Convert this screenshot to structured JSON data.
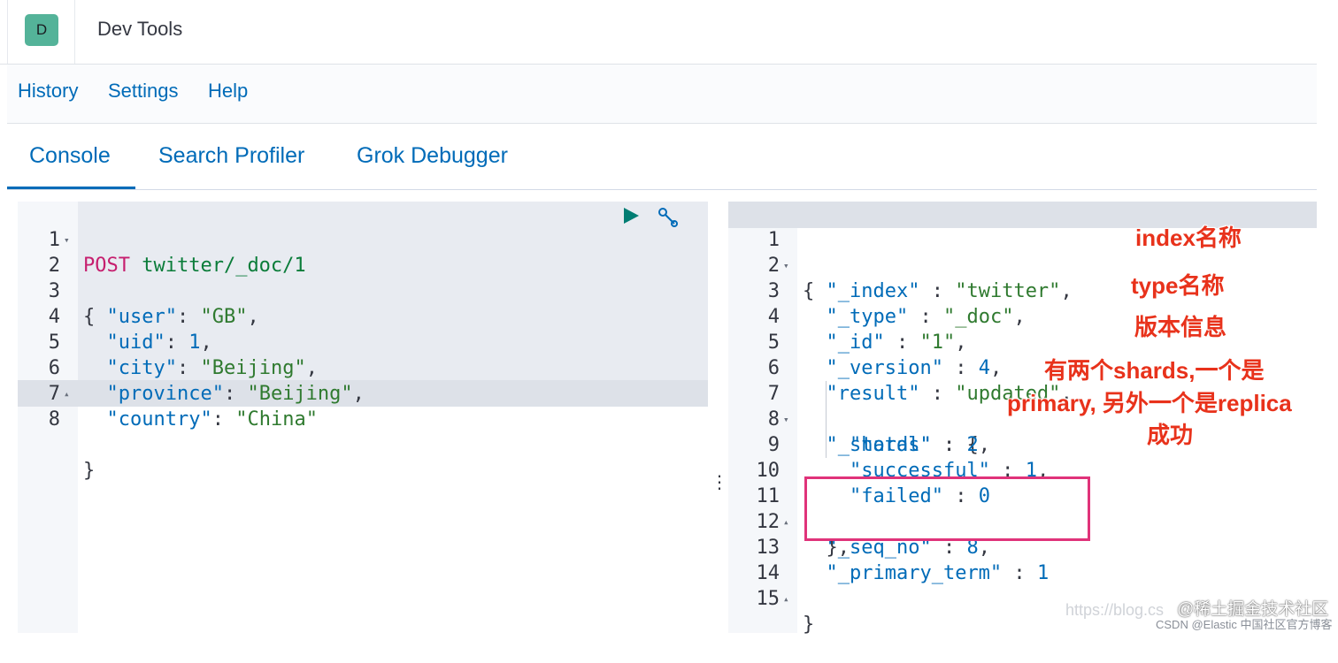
{
  "header": {
    "avatar_letter": "D",
    "title": "Dev Tools"
  },
  "menu": {
    "items": [
      "History",
      "Settings",
      "Help"
    ]
  },
  "tabs": {
    "items": [
      "Console",
      "Search Profiler",
      "Grok Debugger"
    ],
    "active": "Console"
  },
  "request": {
    "lines": [
      {
        "n": "1",
        "text": "POST twitter/_doc/1"
      },
      {
        "n": "2",
        "text": "{"
      },
      {
        "n": "3",
        "text": "  \"user\": \"GB\","
      },
      {
        "n": "4",
        "text": "  \"uid\": 1,"
      },
      {
        "n": "5",
        "text": "  \"city\": \"Beijing\","
      },
      {
        "n": "6",
        "text": "  \"province\": \"Beijing\","
      },
      {
        "n": "7",
        "text": "  \"country\": \"China\""
      },
      {
        "n": "8",
        "text": "}"
      }
    ]
  },
  "response": {
    "lines": [
      {
        "n": "1",
        "text": "{"
      },
      {
        "n": "2",
        "text": "  \"_index\" : \"twitter\","
      },
      {
        "n": "3",
        "text": "  \"_type\" : \"_doc\","
      },
      {
        "n": "4",
        "text": "  \"_id\" : \"1\","
      },
      {
        "n": "5",
        "text": "  \"_version\" : 4,"
      },
      {
        "n": "6",
        "text": "  \"result\" : \"updated\","
      },
      {
        "n": "7",
        "text": "  \"_shards\" : {"
      },
      {
        "n": "8",
        "text": "    \"total\" : 2,"
      },
      {
        "n": "9",
        "text": "    \"successful\" : 1,"
      },
      {
        "n": "10",
        "text": "    \"failed\" : 0"
      },
      {
        "n": "11",
        "text": "  },"
      },
      {
        "n": "12",
        "text": "  \"_seq_no\" : 8,"
      },
      {
        "n": "13",
        "text": "  \"_primary_term\" : 1"
      },
      {
        "n": "14",
        "text": "}"
      },
      {
        "n": "15",
        "text": ""
      }
    ]
  },
  "annotations": {
    "index_name": "index名称",
    "type_name": "type名称",
    "version_info": "版本信息",
    "shards_line1": "有两个shards,一个是",
    "shards_line2": "primary, 另外一个是replica",
    "success": "成功"
  },
  "watermark": {
    "main": "https://blog.cs",
    "brand": "@稀土掘金技术社区",
    "sub": "CSDN @Elastic 中国社区官方博客"
  },
  "colors": {
    "accent": "#006bb8",
    "highlight_box": "#e0337a",
    "annotation": "#e8321b",
    "avatar": "#54b399"
  }
}
